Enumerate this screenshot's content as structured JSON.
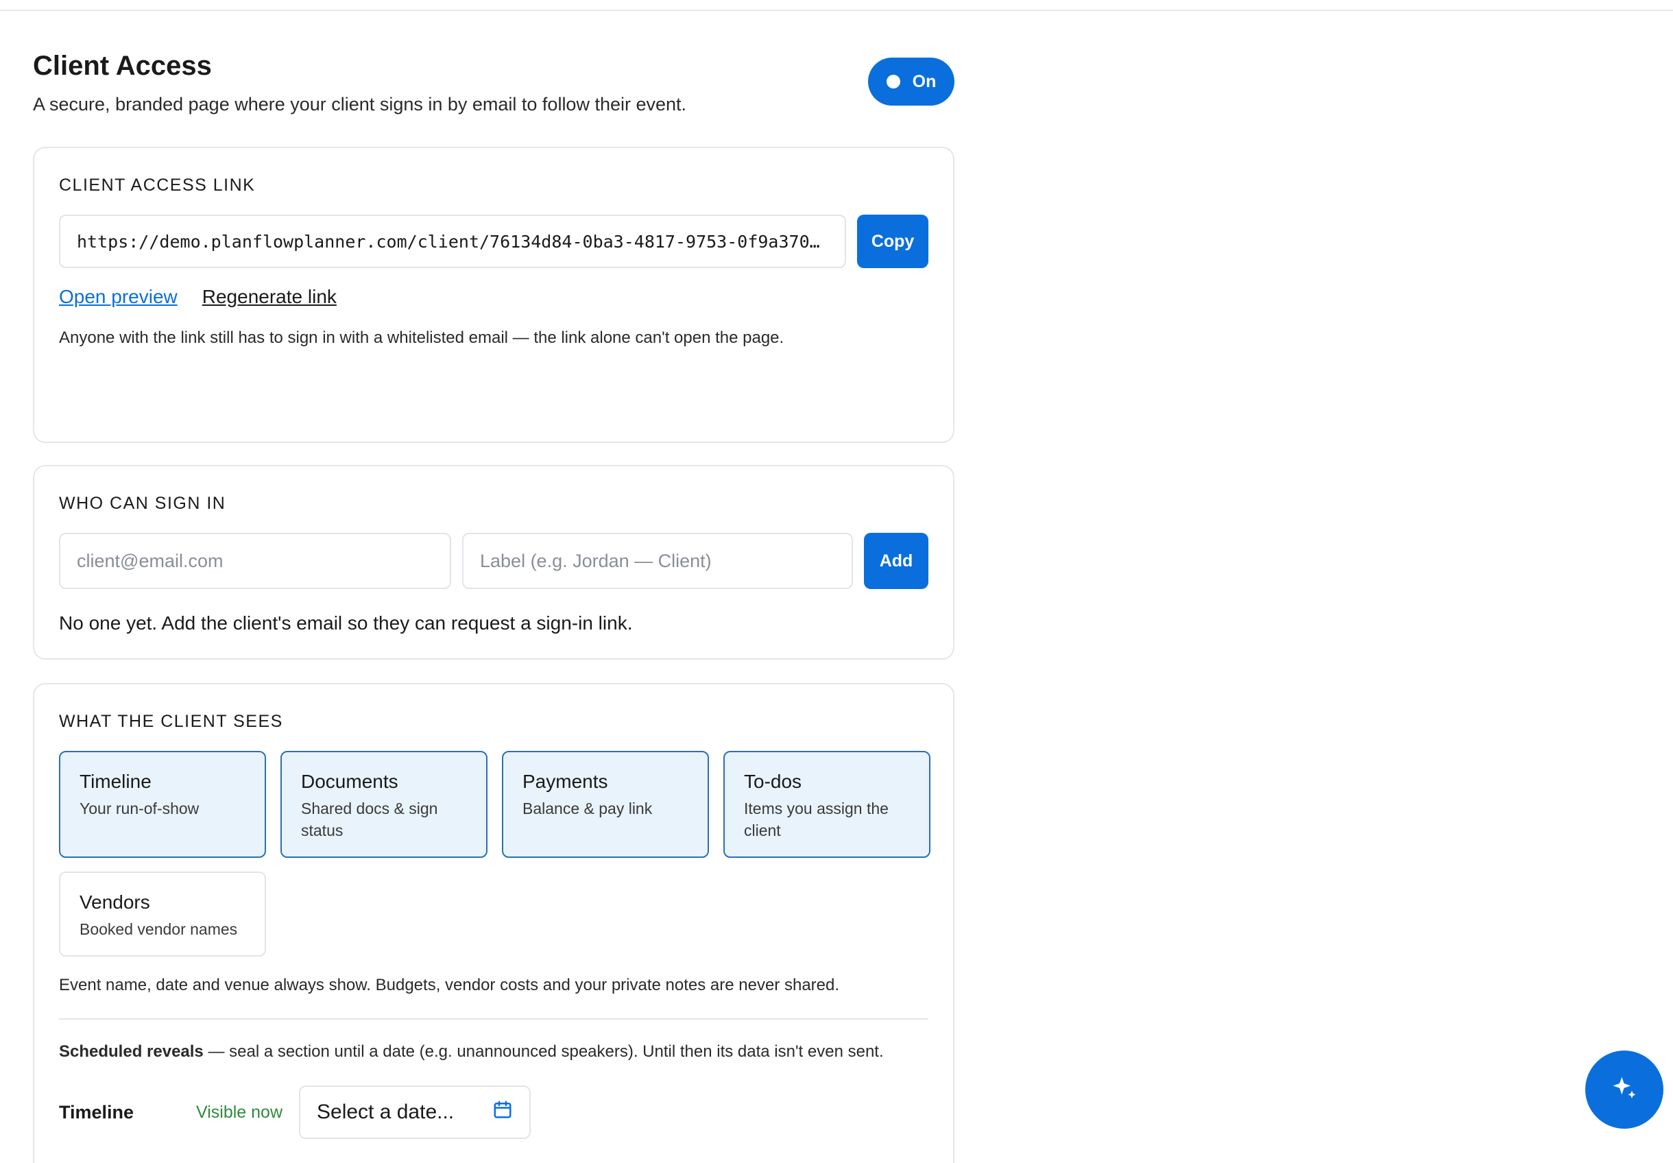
{
  "header": {
    "title": "Client Access",
    "subtitle": "A secure, branded page where your client signs in by email to follow their event.",
    "toggle_label": "On"
  },
  "access_link": {
    "section_label": "CLIENT ACCESS LINK",
    "url": "https://demo.planflowplanner.com/client/76134d84-0ba3-4817-9753-0f9a370…",
    "copy_label": "Copy",
    "open_preview_label": "Open preview",
    "regenerate_label": "Regenerate link",
    "note": "Anyone with the link still has to sign in with a whitelisted email — the link alone can't open the page."
  },
  "sign_in": {
    "section_label": "WHO CAN SIGN IN",
    "email_placeholder": "client@email.com",
    "label_placeholder": "Label (e.g. Jordan — Client)",
    "add_label": "Add",
    "empty_text": "No one yet. Add the client's email so they can request a sign-in link."
  },
  "client_sees": {
    "section_label": "WHAT THE CLIENT SEES",
    "tiles": [
      {
        "title": "Timeline",
        "desc": "Your run-of-show",
        "selected": true
      },
      {
        "title": "Documents",
        "desc": "Shared docs & sign status",
        "selected": true
      },
      {
        "title": "Payments",
        "desc": "Balance & pay link",
        "selected": true
      },
      {
        "title": "To-dos",
        "desc": "Items you assign the client",
        "selected": true
      },
      {
        "title": "Vendors",
        "desc": "Booked vendor names",
        "selected": false
      }
    ],
    "privacy_note": "Event name, date and venue always show. Budgets, vendor costs and your private notes are never shared.",
    "reveals_bold": "Scheduled reveals",
    "reveals_text": " — seal a section until a date (e.g. unannounced speakers). Until then its data isn't even sent.",
    "reveal_rows": [
      {
        "section": "Timeline",
        "status": "Visible now",
        "date_placeholder": "Select a date..."
      }
    ]
  },
  "colors": {
    "accent": "#0a6fdc",
    "tile_selected_bg": "#e9f3fc",
    "tile_selected_border": "#2d6fb3",
    "status_green": "#2e8b3a"
  },
  "icons": {
    "calendar": "calendar-icon",
    "fab": "sparkle-icon"
  }
}
